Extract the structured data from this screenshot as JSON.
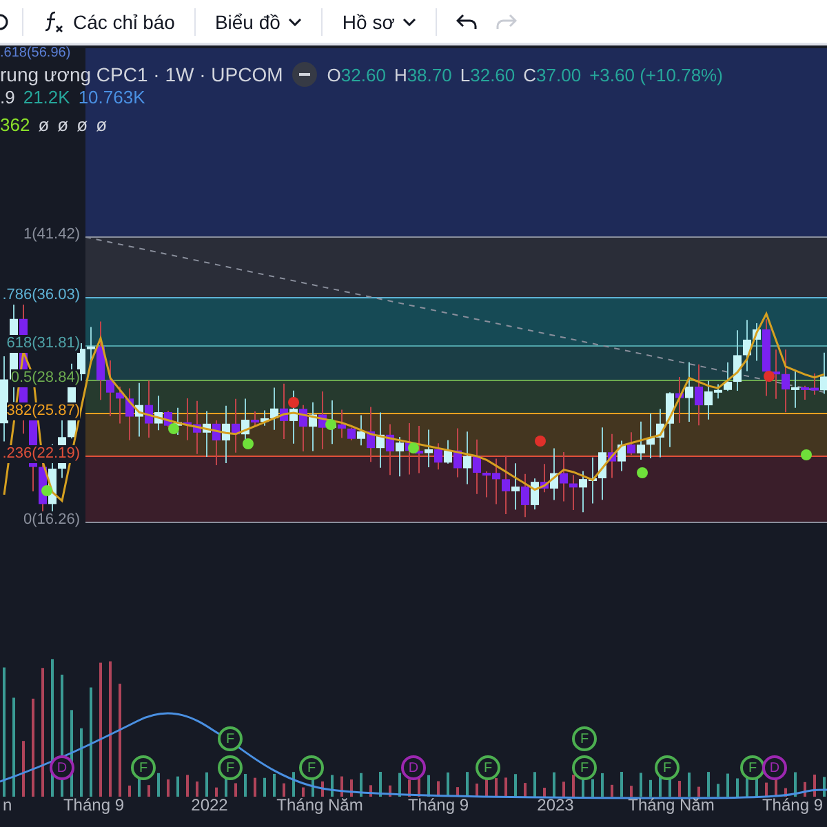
{
  "toolbar": {
    "items": [
      {
        "kind": "indicators",
        "label": "Các chỉ báo"
      },
      {
        "kind": "menu",
        "label": "Biểu đồ"
      },
      {
        "kind": "menu",
        "label": "Hồ sơ"
      }
    ],
    "undo": {
      "disabled": false
    },
    "redo": {
      "disabled": true
    }
  },
  "legend": {
    "top_cut": ".618(56.96)",
    "title": "rung ương CPC1 · 1W · UPCOM",
    "ohlc": [
      {
        "key": "O",
        "value": "32.60"
      },
      {
        "key": "H",
        "value": "38.70"
      },
      {
        "key": "L",
        "value": "32.60"
      },
      {
        "key": "C",
        "value": "37.00"
      }
    ],
    "change": "+3.60 (+10.78%)",
    "volume": [
      ".9",
      "21.2K",
      "10.763K"
    ],
    "indicator": {
      "value": "362",
      "nulls": [
        "ø",
        "ø",
        "ø",
        "ø"
      ]
    }
  },
  "fib_levels": [
    {
      "label": "1(41.42)",
      "color": "#8a8f9c"
    },
    {
      "label": ".786(36.03)",
      "color": "#5fb3d6"
    },
    {
      "label": "618(31.81)",
      "color": "#4fa3a8"
    },
    {
      "label": "0.5(28.84)",
      "color": "#6cab4f"
    },
    {
      "label": "382(25.87)",
      "color": "#f0a020"
    },
    {
      "label": ".236(22.19)",
      "color": "#e0503a"
    },
    {
      "label": "0(16.26)",
      "color": "#8a8f9c"
    }
  ],
  "events": [
    {
      "kind": "earnings",
      "label": "F"
    },
    {
      "kind": "earnings",
      "label": "F"
    },
    {
      "kind": "dividend",
      "label": "D"
    },
    {
      "kind": "earnings",
      "label": "F"
    },
    {
      "kind": "earnings",
      "label": "F"
    },
    {
      "kind": "earnings",
      "label": "F"
    },
    {
      "kind": "dividend",
      "label": "D"
    },
    {
      "kind": "earnings",
      "label": "F"
    },
    {
      "kind": "earnings",
      "label": "F"
    },
    {
      "kind": "earnings",
      "label": "F"
    },
    {
      "kind": "earnings",
      "label": "F"
    },
    {
      "kind": "dividend",
      "label": "D"
    }
  ],
  "time_axis": [
    "n",
    "Tháng 9",
    "2022",
    "Tháng Năm",
    "Tháng 9",
    "2023",
    "Tháng Năm",
    "Tháng 9"
  ]
}
